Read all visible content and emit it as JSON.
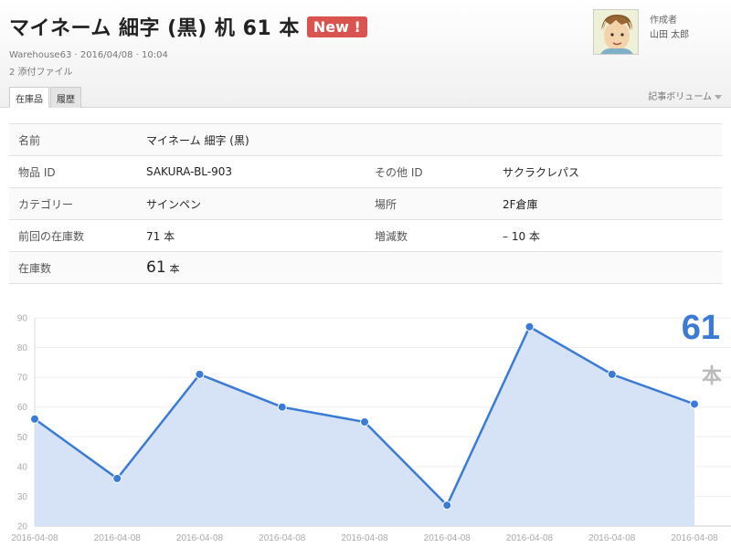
{
  "article": {
    "title": "マイネーム 細字 (黒) 机 61 本",
    "badge": "New !",
    "meta": "Warehouse63 · 2016/04/08 · 10:04",
    "attachments": "2 添付ファイル"
  },
  "author": {
    "label": "作成者",
    "name": "山田 太郎"
  },
  "tabs": [
    {
      "label": "在庫品",
      "active": true
    },
    {
      "label": "履歴",
      "active": false
    }
  ],
  "volume_label": "記事ボリューム",
  "fields": {
    "name_label": "名前",
    "name_value": "マイネーム 細字 (黒)",
    "item_id_label": "物品 ID",
    "item_id_value": "SAKURA-BL-903",
    "other_id_label": "その他 ID",
    "other_id_value": "サクラクレパス",
    "category_label": "カテゴリー",
    "category_value": "サインペン",
    "location_label": "場所",
    "location_value": "2F倉庫",
    "prev_stock_label": "前回の在庫数",
    "prev_stock_value": "71 本",
    "change_label": "増減数",
    "change_value": "– 10 本",
    "stock_label": "在庫数",
    "stock_value": "61",
    "stock_unit": "本"
  },
  "summary": {
    "value": "61",
    "unit": "本"
  },
  "colors": {
    "accent": "#3a7bd5",
    "badge": "#d9534f",
    "area": "#d6e3f6"
  },
  "chart_data": {
    "type": "area",
    "categories": [
      "2016-04-08",
      "2016-04-08",
      "2016-04-08",
      "2016-04-08",
      "2016-04-08",
      "2016-04-08",
      "2016-04-08",
      "2016-04-08",
      "2016-04-08"
    ],
    "values": [
      56,
      36,
      71,
      60,
      55,
      27,
      87,
      71,
      61
    ],
    "ylim": [
      20,
      90
    ],
    "yticks": [
      20,
      30,
      40,
      50,
      60,
      70,
      80,
      90
    ],
    "grid": true,
    "title": "",
    "xlabel": "",
    "ylabel": ""
  }
}
